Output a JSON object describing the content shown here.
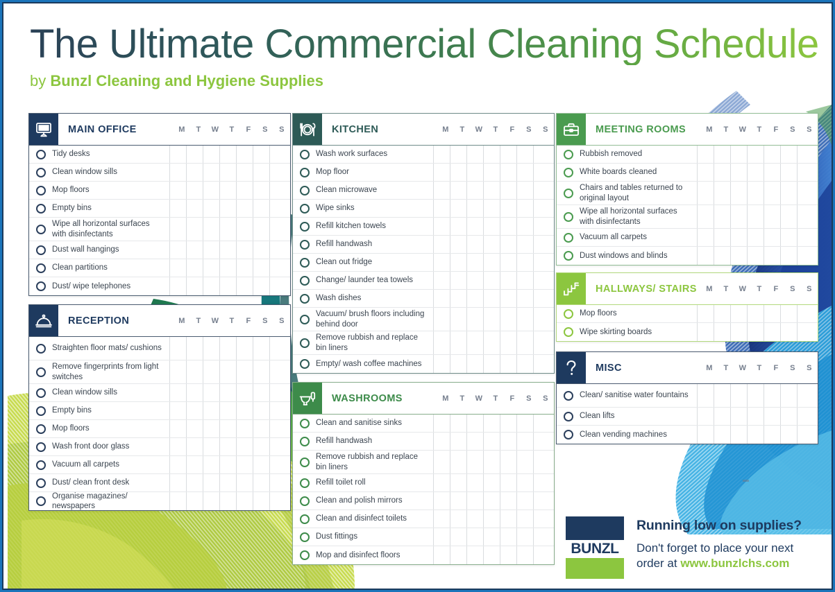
{
  "header": {
    "title": "The Ultimate Commercial Cleaning Schedule",
    "by_prefix": "by ",
    "by_company": "Bunzl Cleaning and Hygiene Supplies"
  },
  "days": [
    "M",
    "T",
    "W",
    "T",
    "F",
    "S",
    "S"
  ],
  "colors": {
    "navy": "#1e3a5f",
    "teal": "#2d5a56",
    "green": "#3d8b4a",
    "meeting_green": "#4a9b4f",
    "lime": "#8cc63f",
    "frame_blue": "#1b75bb",
    "text": "#3b4550"
  },
  "panels": [
    {
      "id": "main-office",
      "title": "MAIN OFFICE",
      "icon": "monitor-icon",
      "theme": "navy",
      "items": [
        "Tidy desks",
        "Clean window sills",
        "Mop floors",
        "Empty bins",
        "Wipe all horizontal surfaces with disinfectants",
        "Dust wall hangings",
        "Clean partitions",
        "Dust/ wipe telephones"
      ]
    },
    {
      "id": "reception",
      "title": "RECEPTION",
      "icon": "service-bell-icon",
      "theme": "navy",
      "items": [
        "Straighten floor mats/ cushions",
        "Remove fingerprints from light switches",
        "Clean window sills",
        "Empty bins",
        "Mop floors",
        "Wash front door glass",
        "Vacuum all carpets",
        "Dust/ clean front desk",
        "Organise magazines/ newspapers"
      ]
    },
    {
      "id": "kitchen",
      "title": "KITCHEN",
      "icon": "plate-cutlery-icon",
      "theme": "teal",
      "items": [
        "Wash work surfaces",
        "Mop floor",
        "Clean microwave",
        "Wipe sinks",
        "Refill kitchen towels",
        "Refill handwash",
        "Clean out fridge",
        "Change/ launder tea towels",
        "Wash dishes",
        "Vacuum/ brush floors including behind door",
        "Remove rubbish and replace bin liners",
        "Empty/ wash coffee machines"
      ]
    },
    {
      "id": "washrooms",
      "title": "WASHROOMS",
      "icon": "toilet-icon",
      "theme": "green",
      "items": [
        "Clean and sanitise sinks",
        "Refill handwash",
        "Remove rubbish and replace bin liners",
        "Refill toilet roll",
        "Clean and polish mirrors",
        "Clean and disinfect toilets",
        "Dust fittings",
        "Mop and disinfect floors"
      ]
    },
    {
      "id": "meeting-rooms",
      "title": "MEETING ROOMS",
      "icon": "briefcase-icon",
      "theme": "mgreen",
      "items": [
        "Rubbish removed",
        "White boards cleaned",
        "Chairs and tables returned to original layout",
        "Wipe all horizontal surfaces with disinfectants",
        "Vacuum all carpets",
        "Dust windows and blinds"
      ]
    },
    {
      "id": "hallways-stairs",
      "title": "HALLWAYS/ STAIRS",
      "icon": "stairs-icon",
      "theme": "lime",
      "items": [
        "Mop floors",
        "Wipe skirting boards"
      ]
    },
    {
      "id": "misc",
      "title": "MISC",
      "icon": "question-mark-icon",
      "theme": "navy",
      "items": [
        "Clean/ sanitise water fountains",
        "Clean lifts",
        "Clean vending machines"
      ]
    }
  ],
  "footer": {
    "logo_text": "BUNZL",
    "headline": "Running low on supplies?",
    "body_line1": "Don't forget to place your next",
    "body_line2_prefix": "order at ",
    "url": "www.bunzlchs.com"
  }
}
